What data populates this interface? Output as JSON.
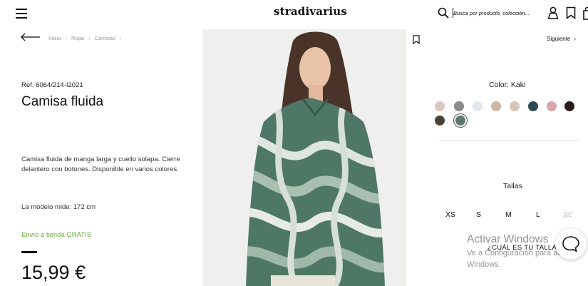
{
  "header": {
    "logo": "stradivarius",
    "search_placeholder": "Busca por producto, colección..."
  },
  "breadcrumb": [
    "Inicio",
    "Ropa",
    "Camisas"
  ],
  "product": {
    "ref": "Ref. 6064/214-I2021",
    "title": "Camisa fluida",
    "description": "Camisa fluida de manga larga y cuello solapa. Cierre delantero con botones. Disponible en varios colores.",
    "model_info": "La modelo mide: 172 cm",
    "shipping": "Envío a tienda GRATIS",
    "price": "15,99 €"
  },
  "nav": {
    "next_label": "Siguiente",
    "next_icon": "chevron-right-icon"
  },
  "colors": {
    "label": "Color: Kaki",
    "swatches": [
      {
        "name": "swatch-1",
        "color": "#d8c8c0"
      },
      {
        "name": "swatch-2",
        "color": "#8a8a8a"
      },
      {
        "name": "swatch-3",
        "color": "#e6e8ef"
      },
      {
        "name": "swatch-4",
        "color": "#cfb5a5"
      },
      {
        "name": "swatch-5",
        "color": "#d6c6b8"
      },
      {
        "name": "swatch-6",
        "color": "#2f4a52"
      },
      {
        "name": "swatch-7",
        "color": "#d9a7ae"
      },
      {
        "name": "swatch-8",
        "color": "#2a1e1c"
      },
      {
        "name": "swatch-9",
        "color": "#4a4038"
      },
      {
        "name": "swatch-10-kaki",
        "color": "#5f7a6b",
        "selected": true
      }
    ]
  },
  "sizes": {
    "label": "Tallas",
    "options": [
      {
        "label": "XS",
        "available": true
      },
      {
        "label": "S",
        "available": true
      },
      {
        "label": "M",
        "available": true
      },
      {
        "label": "L",
        "available": true
      },
      {
        "label": "XL",
        "available": false
      }
    ],
    "guide": "¿CUÁL ES TU TALLA?"
  },
  "windows_watermark": {
    "title": "Activar Windows",
    "line1": "Ve a Configuración para activar",
    "line2": "Windows."
  }
}
